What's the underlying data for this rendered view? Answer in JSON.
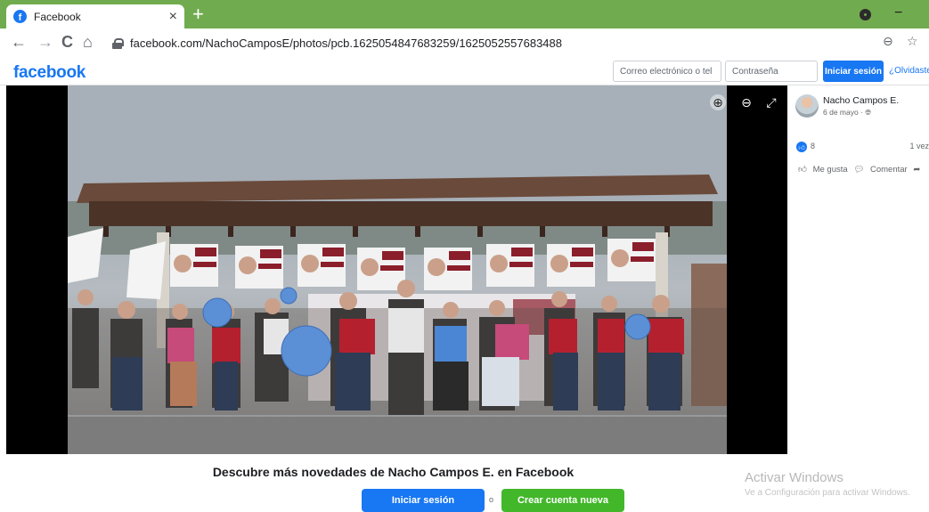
{
  "browser": {
    "tab_title": "Facebook",
    "tab_close": "×",
    "new_tab": "+",
    "url": "facebook.com/NachoCamposE/photos/pcb.1625054847683259/1625052557683488",
    "back": "←",
    "forward": "→",
    "reload": "C",
    "home": "⌂",
    "zoom_icon": "⊖",
    "star": "☆",
    "minimize": "−"
  },
  "header": {
    "logo": "facebook",
    "email_placeholder": "Correo electrónico o tel",
    "password_placeholder": "Contraseña",
    "login_label": "Iniciar sesión",
    "forgot_label": "¿Olvidaste"
  },
  "photo": {
    "banner_word": "morena",
    "poster_line1": "Nacho",
    "poster_line2": "CAMPOS",
    "stage_banner": "Nacho",
    "stage_banner2": "CAMPOS"
  },
  "post": {
    "author": "Nacho Campos E.",
    "date": "6 de mayo · ",
    "likes": "8",
    "shares": "1 vez",
    "like_label": "Me gusta",
    "comment_label": "Comentar"
  },
  "banner": {
    "text": "Descubre más novedades de Nacho Campos E. en Facebook",
    "login_label": "Iniciar sesión",
    "separator": "o",
    "signup_label": "Crear cuenta nueva"
  },
  "watermark": {
    "title": "Activar Windows",
    "subtitle": "Ve a Configuración para activar Windows."
  },
  "colors": {
    "tab_bar": "#71ab4f",
    "fb_blue": "#1877f2",
    "signup_green": "#42b72a",
    "privacy_blur": "#5b8fd6"
  }
}
